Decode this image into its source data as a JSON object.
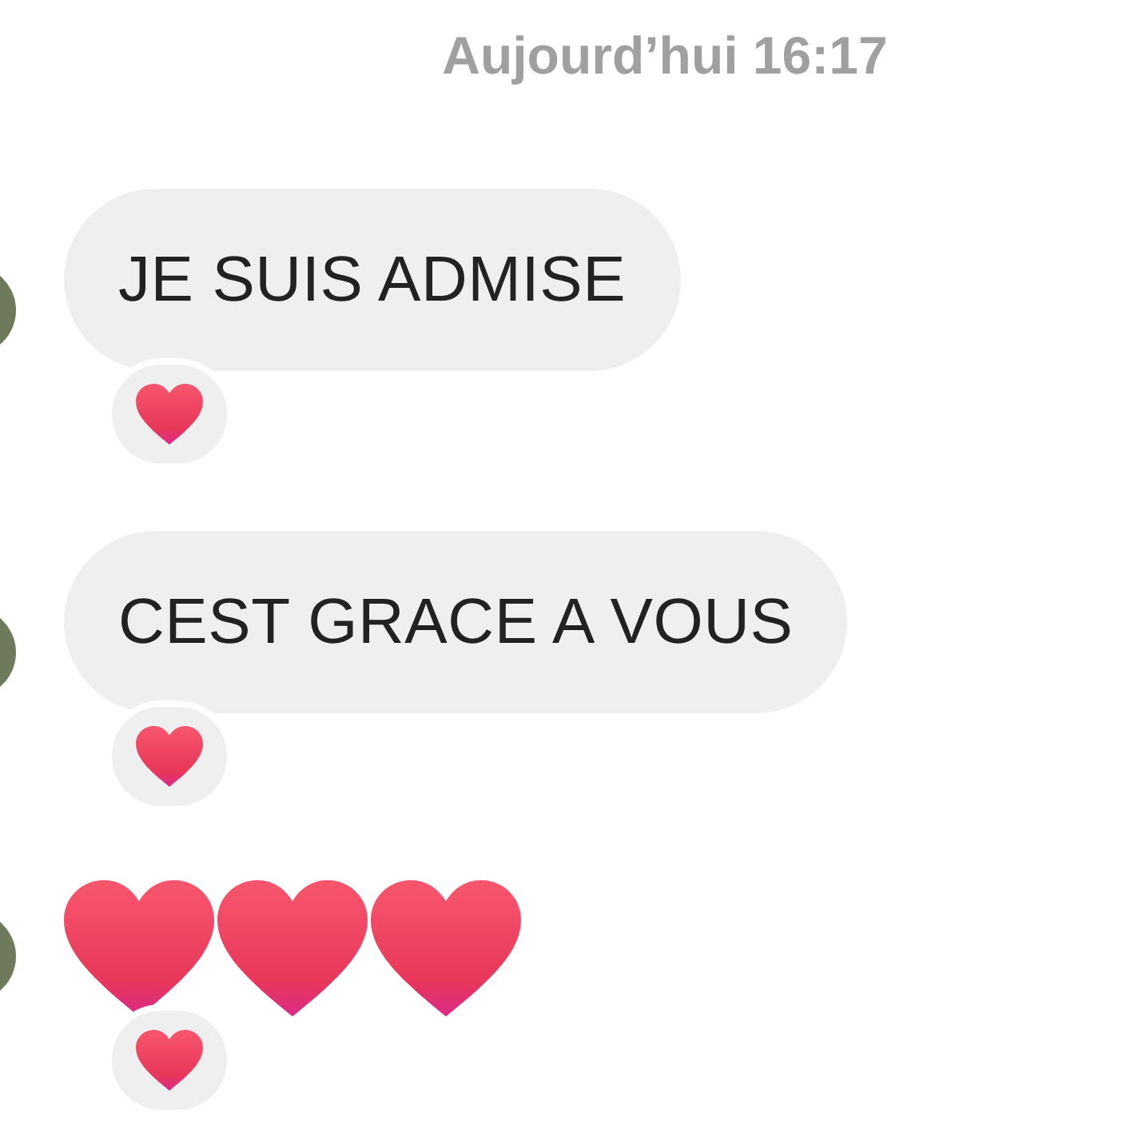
{
  "timestamp": "Aujourd’hui 16:17",
  "messages": [
    {
      "kind": "text",
      "text": "JE SUIS ADMISE",
      "reacted": true
    },
    {
      "kind": "text",
      "text": "CEST GRACE A VOUS",
      "reacted": true
    },
    {
      "kind": "hearts",
      "reacted": true
    }
  ]
}
